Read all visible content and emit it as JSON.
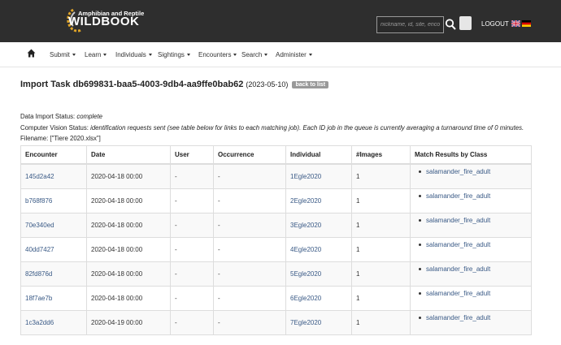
{
  "header": {
    "logo_line1": "Amphibian and Reptile",
    "logo_line2": "WILDBOOK",
    "search_placeholder": "nickname, id, site, encou",
    "logout_label": "LOGOUT",
    "languages": [
      "en-flag-icon",
      "de-flag-icon"
    ]
  },
  "nav": {
    "items": [
      {
        "label": "Submit"
      },
      {
        "label": "Learn"
      },
      {
        "label": "Individuals"
      },
      {
        "label": "Sightings"
      },
      {
        "label": "Encounters"
      },
      {
        "label": "Search"
      },
      {
        "label": "Administer"
      }
    ]
  },
  "task": {
    "title": "Import Task db699831-baa5-4003-9db4-aa9ffe0bab62",
    "date": "(2023-05-10)",
    "back_label": "back to list",
    "import_status_label": "Data Import Status:",
    "import_status_value": "complete",
    "cv_status_label": "Computer Vision Status:",
    "cv_status_value": "identification requests sent (see table below for links to each matching job). Each ID job in the queue is currently averaging a turnaround time of 0 minutes.",
    "filename_label": "Filename:",
    "filename_value": "[\"Tiere 2020.xlsx\"]"
  },
  "table": {
    "headers": [
      "Encounter",
      "Date",
      "User",
      "Occurrence",
      "Individual",
      "#Images",
      "Match Results by Class"
    ],
    "rows": [
      {
        "encounter": "145d2a42",
        "date": "2020-04-18 00:00",
        "user": "-",
        "occurrence": "-",
        "individual": "1Egle2020",
        "images": "1",
        "match": "salamander_fire_adult"
      },
      {
        "encounter": "b768f876",
        "date": "2020-04-18 00:00",
        "user": "-",
        "occurrence": "-",
        "individual": "2Egle2020",
        "images": "1",
        "match": "salamander_fire_adult"
      },
      {
        "encounter": "70e340ed",
        "date": "2020-04-18 00:00",
        "user": "-",
        "occurrence": "-",
        "individual": "3Egle2020",
        "images": "1",
        "match": "salamander_fire_adult"
      },
      {
        "encounter": "40dd7427",
        "date": "2020-04-18 00:00",
        "user": "-",
        "occurrence": "-",
        "individual": "4Egle2020",
        "images": "1",
        "match": "salamander_fire_adult"
      },
      {
        "encounter": "82fd876d",
        "date": "2020-04-18 00:00",
        "user": "-",
        "occurrence": "-",
        "individual": "5Egle2020",
        "images": "1",
        "match": "salamander_fire_adult"
      },
      {
        "encounter": "18f7ae7b",
        "date": "2020-04-18 00:00",
        "user": "-",
        "occurrence": "-",
        "individual": "6Egle2020",
        "images": "1",
        "match": "salamander_fire_adult"
      },
      {
        "encounter": "1c3a2dd6",
        "date": "2020-04-19 00:00",
        "user": "-",
        "occurrence": "-",
        "individual": "7Egle2020",
        "images": "1",
        "match": "salamander_fire_adult"
      }
    ]
  },
  "colors": {
    "header_bg": "#2e2e2e",
    "link": "#3a5a86",
    "logo_accent": "#e0a528"
  }
}
